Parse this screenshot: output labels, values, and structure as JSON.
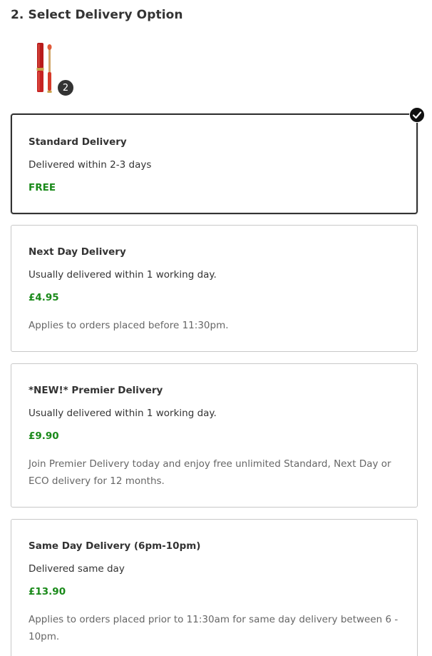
{
  "section": {
    "title": "2. Select Delivery Option"
  },
  "basket": {
    "quantity": "2",
    "product_icon": "lip-gloss-product-image"
  },
  "colors": {
    "price": "#1a8a1a",
    "selected_border": "#333333",
    "card_border": "#c8c8c8"
  },
  "options": [
    {
      "name": "Standard Delivery",
      "description": "Delivered within 2-3 days",
      "price": "FREE",
      "note": "",
      "selected": true
    },
    {
      "name": "Next Day Delivery",
      "description": "Usually delivered within 1 working day.",
      "price": "£4.95",
      "note": "Applies to orders placed before 11:30pm.",
      "selected": false
    },
    {
      "name": "*NEW!* Premier Delivery",
      "description": "Usually delivered within 1 working day.",
      "price": "£9.90",
      "note": "Join Premier Delivery today and enjoy free unlimited Standard, Next Day or ECO delivery for 12 months.",
      "selected": false
    },
    {
      "name": "Same Day Delivery (6pm-10pm)",
      "description": "Delivered same day",
      "price": "£13.90",
      "note": "Applies to orders placed prior to 11:30am for same day delivery between 6 - 10pm.",
      "selected": false
    }
  ]
}
